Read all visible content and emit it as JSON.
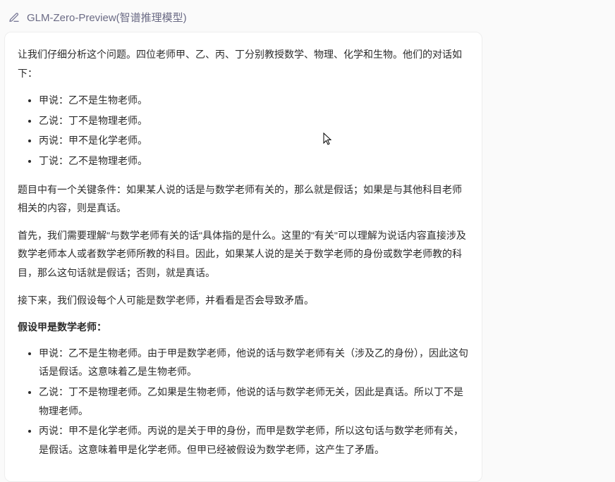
{
  "header": {
    "icon_name": "edit-icon",
    "title": "GLM-Zero-Preview(智谱推理模型)"
  },
  "content": {
    "intro": "让我们仔细分析这个问题。四位老师甲、乙、丙、丁分别教授数学、物理、化学和生物。他们的对话如下：",
    "dialog": [
      "甲说：乙不是生物老师。",
      "乙说：丁不是物理老师。",
      "丙说：甲不是化学老师。",
      "丁说：乙不是物理老师。"
    ],
    "rule": "题目中有一个关键条件：如果某人说的话是与数学老师有关的，那么就是假话；如果是与其他科目老师相关的内容，则是真话。",
    "explain": "首先，我们需要理解\"与数学老师有关的话\"具体指的是什么。这里的\"有关\"可以理解为说话内容直接涉及数学老师本人或者数学老师所教的科目。因此，如果某人说的是关于数学老师的身份或数学老师教的科目，那么这句话就是假话；否则，就是真话。",
    "next": "接下来，我们假设每个人可能是数学老师，并看看是否会导致矛盾。",
    "assume_heading": "假设甲是数学老师：",
    "assume_bullets": [
      "甲说：乙不是生物老师。由于甲是数学老师，他说的话与数学老师有关（涉及乙的身份），因此这句话是假话。这意味着乙是生物老师。",
      "乙说：丁不是物理老师。乙如果是生物老师，他说的话与数学老师无关，因此是真话。所以丁不是物理老师。",
      "丙说：甲不是化学老师。丙说的是关于甲的身份，而甲是数学老师，所以这句话与数学老师有关，是假话。这意味着甲是化学老师。但甲已经被假设为数学老师，这产生了矛盾。"
    ]
  }
}
